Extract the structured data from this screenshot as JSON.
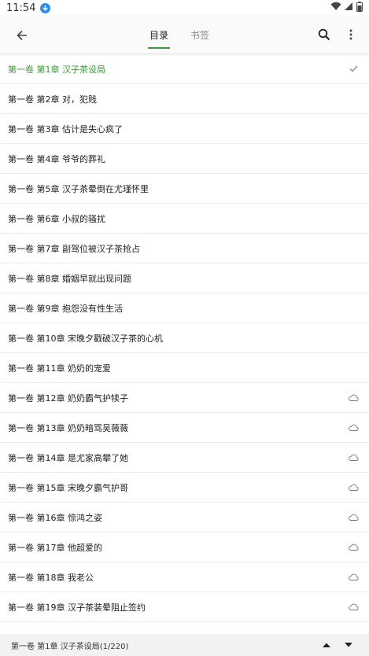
{
  "status_bar": {
    "time": "11:54",
    "icons": [
      "download-badge-icon",
      "wifi-icon",
      "signal-icon",
      "battery-icon"
    ]
  },
  "toolbar": {
    "tabs": [
      {
        "label": "目录",
        "active": true
      },
      {
        "label": "书签",
        "active": false
      }
    ],
    "icons": [
      "back-arrow-icon",
      "search-icon",
      "more-vert-icon"
    ]
  },
  "chapters": [
    {
      "title": "第一卷 第1章 汉子茶设局",
      "status": "current"
    },
    {
      "title": "第一卷 第2章 对，犯贱",
      "status": "downloaded"
    },
    {
      "title": "第一卷 第3章 估计是失心疯了",
      "status": "downloaded"
    },
    {
      "title": "第一卷 第4章 爷爷的葬礼",
      "status": "downloaded"
    },
    {
      "title": "第一卷 第5章 汉子茶晕倒在尤瑾怀里",
      "status": "downloaded"
    },
    {
      "title": "第一卷 第6章 小叔的骚扰",
      "status": "downloaded"
    },
    {
      "title": "第一卷 第7章 副驾位被汉子茶抢占",
      "status": "downloaded"
    },
    {
      "title": "第一卷 第8章 婚姻早就出现问题",
      "status": "downloaded"
    },
    {
      "title": "第一卷 第9章 抱怨没有性生活",
      "status": "downloaded"
    },
    {
      "title": "第一卷 第10章 宋晚夕戳破汉子茶的心机",
      "status": "downloaded"
    },
    {
      "title": "第一卷 第11章 奶奶的宠爱",
      "status": "downloaded"
    },
    {
      "title": "第一卷 第12章 奶奶霸气护犊子",
      "status": "cloud"
    },
    {
      "title": "第一卷 第13章 奶奶暗骂吴薇薇",
      "status": "cloud"
    },
    {
      "title": "第一卷 第14章 是尤家高攀了她",
      "status": "cloud"
    },
    {
      "title": "第一卷 第15章 宋晚夕霸气护哥",
      "status": "cloud"
    },
    {
      "title": "第一卷 第16章 惊鸿之姿",
      "status": "cloud"
    },
    {
      "title": "第一卷 第17章 他超爱的",
      "status": "cloud"
    },
    {
      "title": "第一卷 第18章 我老公",
      "status": "cloud"
    },
    {
      "title": "第一卷 第19章 汉子茶装晕阻止签约",
      "status": "cloud"
    }
  ],
  "bottom_bar": {
    "current_info": "第一卷 第1章 汉子茶设局(1/220)",
    "icons": [
      "arrow-up-icon",
      "arrow-down-icon"
    ]
  },
  "colors": {
    "accent": "#3c9a3c",
    "text": "#222222",
    "divider": "#ececec"
  }
}
